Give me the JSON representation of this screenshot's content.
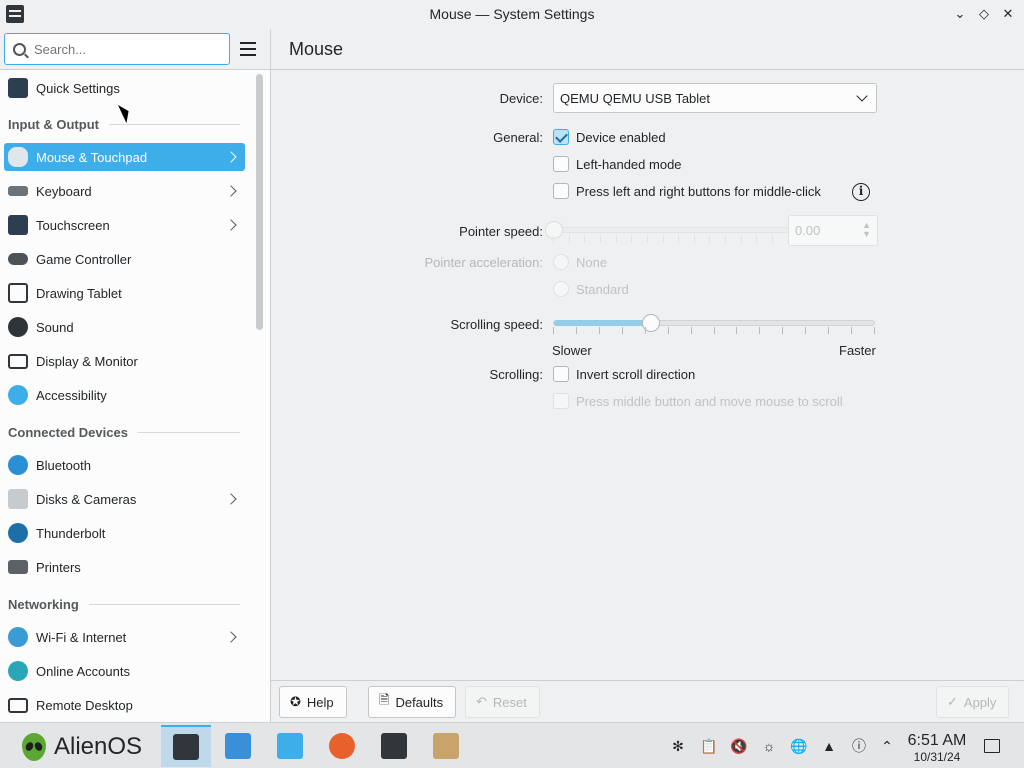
{
  "window": {
    "title": "Mouse — System Settings"
  },
  "header": {
    "search_placeholder": "Search...",
    "page_title": "Mouse"
  },
  "sidebar": {
    "quick_settings": "Quick Settings",
    "sections": {
      "input_output": "Input & Output",
      "connected_devices": "Connected Devices",
      "networking": "Networking"
    },
    "items": [
      {
        "label": "Mouse & Touchpad",
        "icon": "mouse-icon",
        "active": true,
        "chevron": true
      },
      {
        "label": "Keyboard",
        "icon": "keyboard-icon",
        "chevron": true
      },
      {
        "label": "Touchscreen",
        "icon": "touchscreen-icon",
        "chevron": true
      },
      {
        "label": "Game Controller",
        "icon": "gamepad-icon"
      },
      {
        "label": "Drawing Tablet",
        "icon": "tablet-icon"
      },
      {
        "label": "Sound",
        "icon": "speaker-icon"
      },
      {
        "label": "Display & Monitor",
        "icon": "monitor-icon"
      },
      {
        "label": "Accessibility",
        "icon": "accessibility-icon"
      },
      {
        "label": "Bluetooth",
        "icon": "bluetooth-icon"
      },
      {
        "label": "Disks & Cameras",
        "icon": "disk-icon",
        "chevron": true
      },
      {
        "label": "Thunderbolt",
        "icon": "thunderbolt-icon"
      },
      {
        "label": "Printers",
        "icon": "printer-icon"
      },
      {
        "label": "Wi-Fi & Internet",
        "icon": "globe-icon",
        "chevron": true
      },
      {
        "label": "Online Accounts",
        "icon": "online-accounts-icon"
      },
      {
        "label": "Remote Desktop",
        "icon": "remote-desktop-icon"
      }
    ]
  },
  "main": {
    "device_label": "Device:",
    "device_value": "QEMU QEMU USB Tablet",
    "general_label": "General:",
    "device_enabled": "Device enabled",
    "left_handed": "Left-handed mode",
    "middle_click": "Press left and right buttons for middle-click",
    "pointer_speed_label": "Pointer speed:",
    "pointer_speed_value": "0.00",
    "pointer_accel_label": "Pointer acceleration:",
    "accel_none": "None",
    "accel_standard": "Standard",
    "scrolling_speed_label": "Scrolling speed:",
    "scrolling_speed_level": 0.3,
    "slower": "Slower",
    "faster": "Faster",
    "scrolling_label": "Scrolling:",
    "invert_scroll": "Invert scroll direction",
    "middle_scroll": "Press middle button and move mouse to scroll",
    "info_glyph": "i"
  },
  "footer": {
    "help": "Help",
    "defaults": "Defaults",
    "reset": "Reset",
    "apply": "Apply"
  },
  "taskbar": {
    "start_label": "AlienOS",
    "time": "6:51 AM",
    "date": "10/31/24"
  },
  "colors": {
    "accent": "#3daee9",
    "accent_soft": "#93cee9",
    "window_bg": "#eff0f1"
  }
}
